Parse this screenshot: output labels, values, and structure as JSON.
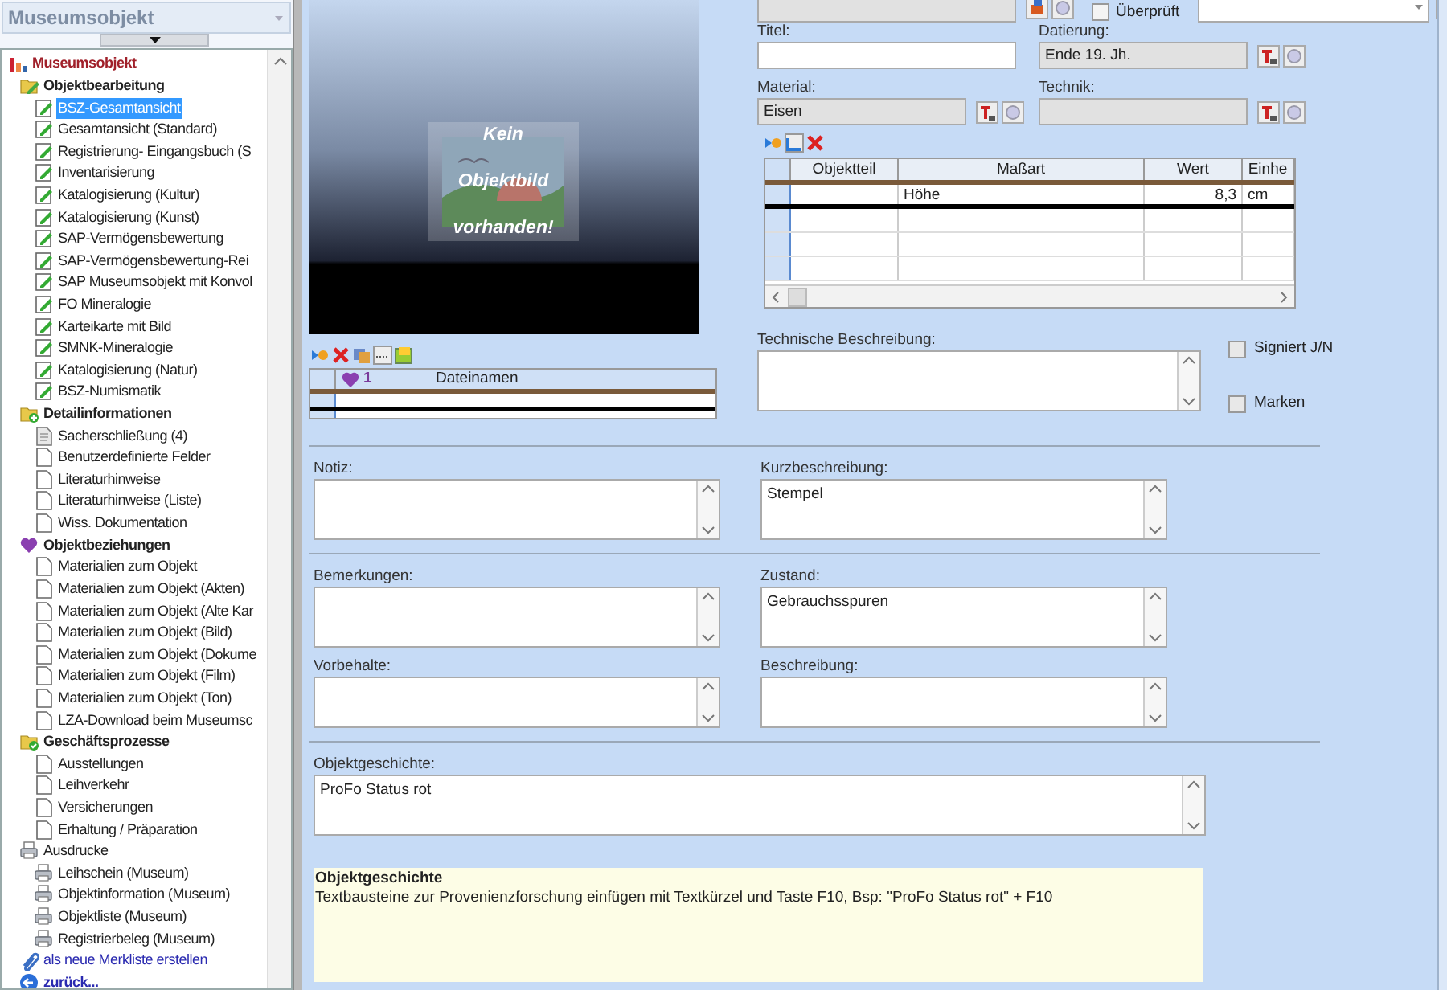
{
  "sidebar": {
    "selector": {
      "value": "Museumsobjekt"
    },
    "tree": [
      {
        "label": "Museumsobjekt",
        "kind": "root",
        "selected": false,
        "children": [
          {
            "label": "Objektbearbeitung",
            "kind": "edit-folder",
            "selected": false,
            "children": [
              {
                "label": "BSZ-Gesamtansicht",
                "kind": "form",
                "selected": true
              },
              {
                "label": "Gesamtansicht (Standard)",
                "kind": "form",
                "selected": false
              },
              {
                "label": "Registrierung- Eingangsbuch (S",
                "kind": "form",
                "selected": false
              },
              {
                "label": "Inventarisierung",
                "kind": "form",
                "selected": false
              },
              {
                "label": "Katalogisierung (Kultur)",
                "kind": "form",
                "selected": false
              },
              {
                "label": "Katalogisierung (Kunst)",
                "kind": "form",
                "selected": false
              },
              {
                "label": "SAP-Vermögensbewertung",
                "kind": "form",
                "selected": false
              },
              {
                "label": "SAP-Vermögensbewertung-Rei",
                "kind": "form",
                "selected": false
              },
              {
                "label": "SAP Museumsobjekt mit Konvol",
                "kind": "form",
                "selected": false
              },
              {
                "label": "FO Mineralogie",
                "kind": "form",
                "selected": false
              },
              {
                "label": "Karteikarte mit Bild",
                "kind": "form",
                "selected": false
              },
              {
                "label": "SMNK-Mineralogie",
                "kind": "form",
                "selected": false
              },
              {
                "label": "Katalogisierung (Natur)",
                "kind": "form",
                "selected": false
              },
              {
                "label": "BSZ-Numismatik",
                "kind": "form",
                "selected": false
              }
            ]
          },
          {
            "label": "Detailinformationen",
            "kind": "info-folder",
            "selected": false,
            "children": [
              {
                "label": "Sacherschließung (4)",
                "kind": "filled-page",
                "selected": false
              },
              {
                "label": "Benutzerdefinierte Felder",
                "kind": "page",
                "selected": false
              },
              {
                "label": "Literaturhinweise",
                "kind": "page",
                "selected": false
              },
              {
                "label": "Literaturhinweise (Liste)",
                "kind": "page",
                "selected": false
              },
              {
                "label": "Wiss. Dokumentation",
                "kind": "page",
                "selected": false
              }
            ]
          },
          {
            "label": "Objektbeziehungen",
            "kind": "relations",
            "selected": false,
            "children": [
              {
                "label": "Materialien zum Objekt",
                "kind": "page",
                "selected": false
              },
              {
                "label": "Materialien zum Objekt (Akten)",
                "kind": "page",
                "selected": false
              },
              {
                "label": "Materialien zum Objekt (Alte Kar",
                "kind": "page",
                "selected": false
              },
              {
                "label": "Materialien zum Objekt (Bild)",
                "kind": "page",
                "selected": false
              },
              {
                "label": "Materialien zum Objekt (Dokume",
                "kind": "page",
                "selected": false
              },
              {
                "label": "Materialien zum Objekt (Film)",
                "kind": "page",
                "selected": false
              },
              {
                "label": "Materialien zum Objekt (Ton)",
                "kind": "page",
                "selected": false
              },
              {
                "label": "LZA-Download beim Museumsc",
                "kind": "page",
                "selected": false
              }
            ]
          },
          {
            "label": "Geschäftsprozesse",
            "kind": "process-folder",
            "selected": false,
            "children": [
              {
                "label": "Ausstellungen",
                "kind": "page",
                "selected": false
              },
              {
                "label": "Leihverkehr",
                "kind": "page",
                "selected": false
              },
              {
                "label": "Versicherungen",
                "kind": "page",
                "selected": false
              },
              {
                "label": "Erhaltung / Präparation",
                "kind": "page",
                "selected": false
              }
            ]
          },
          {
            "label": "Ausdrucke",
            "kind": "print",
            "selected": false,
            "children": [
              {
                "label": "Leihschein (Museum)",
                "kind": "print",
                "selected": false
              },
              {
                "label": "Objektinformation (Museum)",
                "kind": "print",
                "selected": false
              },
              {
                "label": "Objektliste (Museum)",
                "kind": "print",
                "selected": false
              },
              {
                "label": "Registrierbeleg (Museum)",
                "kind": "print",
                "selected": false
              }
            ]
          },
          {
            "label": "als neue Merkliste erstellen",
            "kind": "link",
            "selected": false
          },
          {
            "label": "zurück...",
            "kind": "back",
            "selected": false
          }
        ]
      }
    ]
  },
  "image": {
    "lines": [
      "Kein",
      "Objektbild",
      "vorhanden!"
    ]
  },
  "file_table": {
    "columns": [
      "1",
      "Dateinamen"
    ]
  },
  "review": {
    "label": "Überprüft",
    "checked": false
  },
  "fields": [
    {
      "label": "Titel:",
      "kind": "text"
    },
    {
      "label": "Datierung:",
      "kind": "lookup",
      "value": "Ende 19. Jh."
    },
    {
      "label": "Material:",
      "kind": "lookup",
      "value": "Eisen"
    },
    {
      "label": "Technik:",
      "kind": "lookup"
    }
  ],
  "dimensions": {
    "columns": [
      "Objektteil",
      "Maßart",
      "Wert",
      "Einhe"
    ],
    "rows": [
      {
        "type": "Höhe",
        "value": "8,3",
        "unit": "cm"
      }
    ]
  },
  "technical_description": {
    "label": "Technische Beschreibung:"
  },
  "checkboxes": [
    {
      "label": "Signiert J/N",
      "checked": false
    },
    {
      "label": "Marken",
      "checked": false
    }
  ],
  "sections": [
    {
      "rows": [
        [
          {
            "label": "Notiz:"
          },
          {
            "label": "Kurzbeschreibung:",
            "value": "Stempel"
          }
        ]
      ]
    },
    {
      "rows": [
        [
          {
            "label": "Bemerkungen:"
          },
          {
            "label": "Zustand:",
            "value": "Gebrauchsspuren"
          }
        ],
        [
          {
            "label": "Vorbehalte:"
          },
          {
            "label": "Beschreibung:"
          }
        ]
      ]
    },
    {
      "rows": [
        [
          {
            "label": "Objektgeschichte:",
            "value": "ProFo Status rot",
            "wide": true
          }
        ]
      ]
    }
  ],
  "help": {
    "title": "Objektgeschichte",
    "text": "Textbausteine zur Provenienzforschung einfügen mit Textkürzel und Taste F10, Bsp: \"ProFo Status rot\" + F10"
  }
}
